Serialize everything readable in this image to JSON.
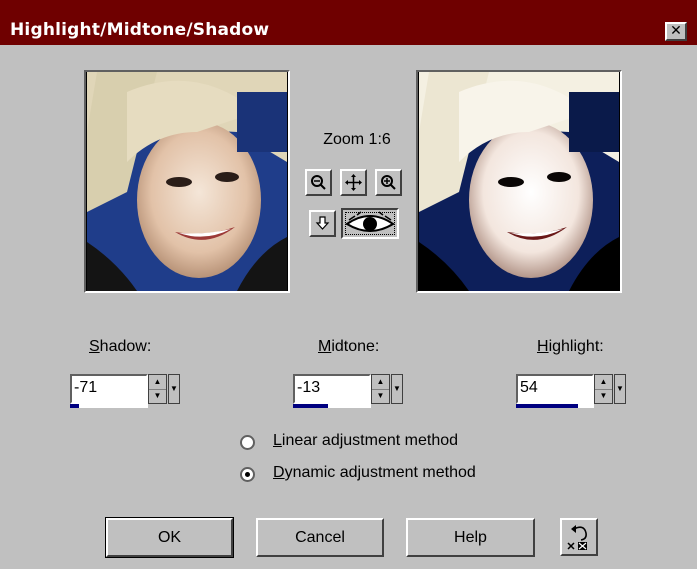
{
  "window": {
    "title": "Highlight/Midtone/Shadow",
    "close_glyph": "✕"
  },
  "preview": {
    "zoom_label": "Zoom 1:6",
    "before_image": "portrait-original",
    "after_image": "portrait-adjusted"
  },
  "tools": {
    "zoom_out_icon": "zoom-out-icon",
    "pan_icon": "move-icon",
    "zoom_in_icon": "zoom-in-icon",
    "locate_icon": "locate-arrow-icon",
    "preview_icon": "eye-icon"
  },
  "fields": {
    "shadow": {
      "label_key": "S",
      "label_rest": "hadow:",
      "value": "-71",
      "level": 0.12
    },
    "midtone": {
      "label_key": "M",
      "label_rest": "idtone:",
      "value": "-13",
      "level": 0.45
    },
    "highlight": {
      "label_key": "H",
      "label_rest": "ighlight:",
      "value": "54",
      "level": 0.8
    }
  },
  "method": {
    "linear": {
      "key": "L",
      "rest": "inear adjustment method",
      "selected": false
    },
    "dynamic": {
      "key": "D",
      "rest": "ynamic adjustment method",
      "selected": true
    }
  },
  "buttons": {
    "ok": "OK",
    "cancel": "Cancel",
    "help": "Help",
    "reset_icon": "undo-reset-icon"
  },
  "colors": {
    "title_bar": "#6f0000",
    "dialog_bg": "#c0c0c0",
    "level_bar": "#000080"
  }
}
